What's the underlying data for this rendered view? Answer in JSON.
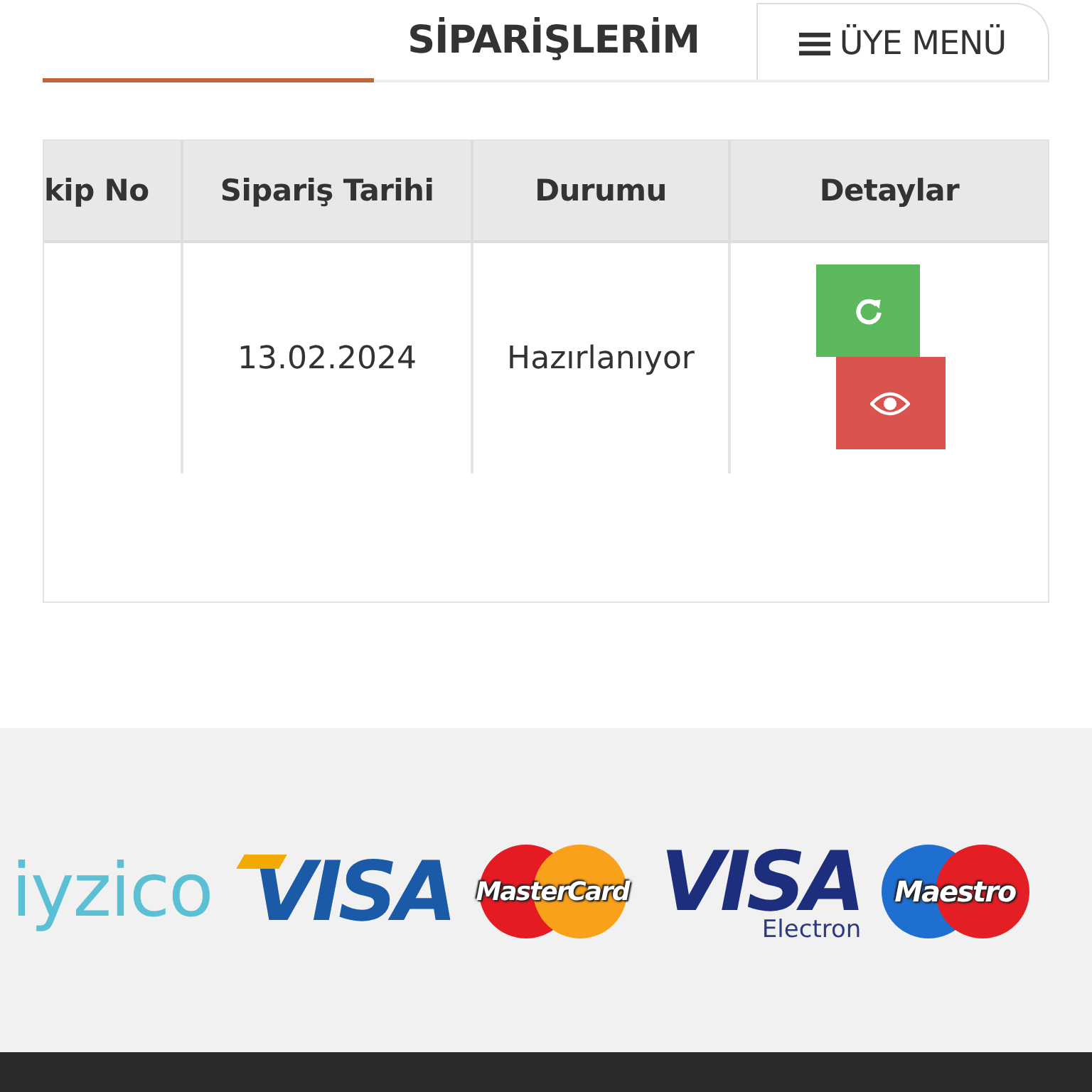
{
  "header": {
    "title": "SİPARİŞLERİM",
    "menu_button": "ÜYE MENÜ"
  },
  "table": {
    "columns": [
      "kip No",
      "Sipariş Tarihi",
      "Durumu",
      "Detaylar"
    ],
    "rows": [
      {
        "cells": [
          "",
          "13.02.2024",
          "Hazırlanıyor"
        ],
        "actions": [
          {
            "kind": "refresh",
            "color": "#5cb85c"
          },
          {
            "kind": "view",
            "color": "#d9534f"
          }
        ]
      }
    ]
  },
  "footer": {
    "payment_logos": [
      {
        "kind": "iyzico",
        "text": "iyzico"
      },
      {
        "kind": "visa",
        "text": "VISA"
      },
      {
        "kind": "mastercard",
        "text": "MasterCard"
      },
      {
        "kind": "visa",
        "text": "VISA",
        "subtext": "Electron"
      },
      {
        "kind": "maestro",
        "text": "Maestro"
      }
    ]
  }
}
